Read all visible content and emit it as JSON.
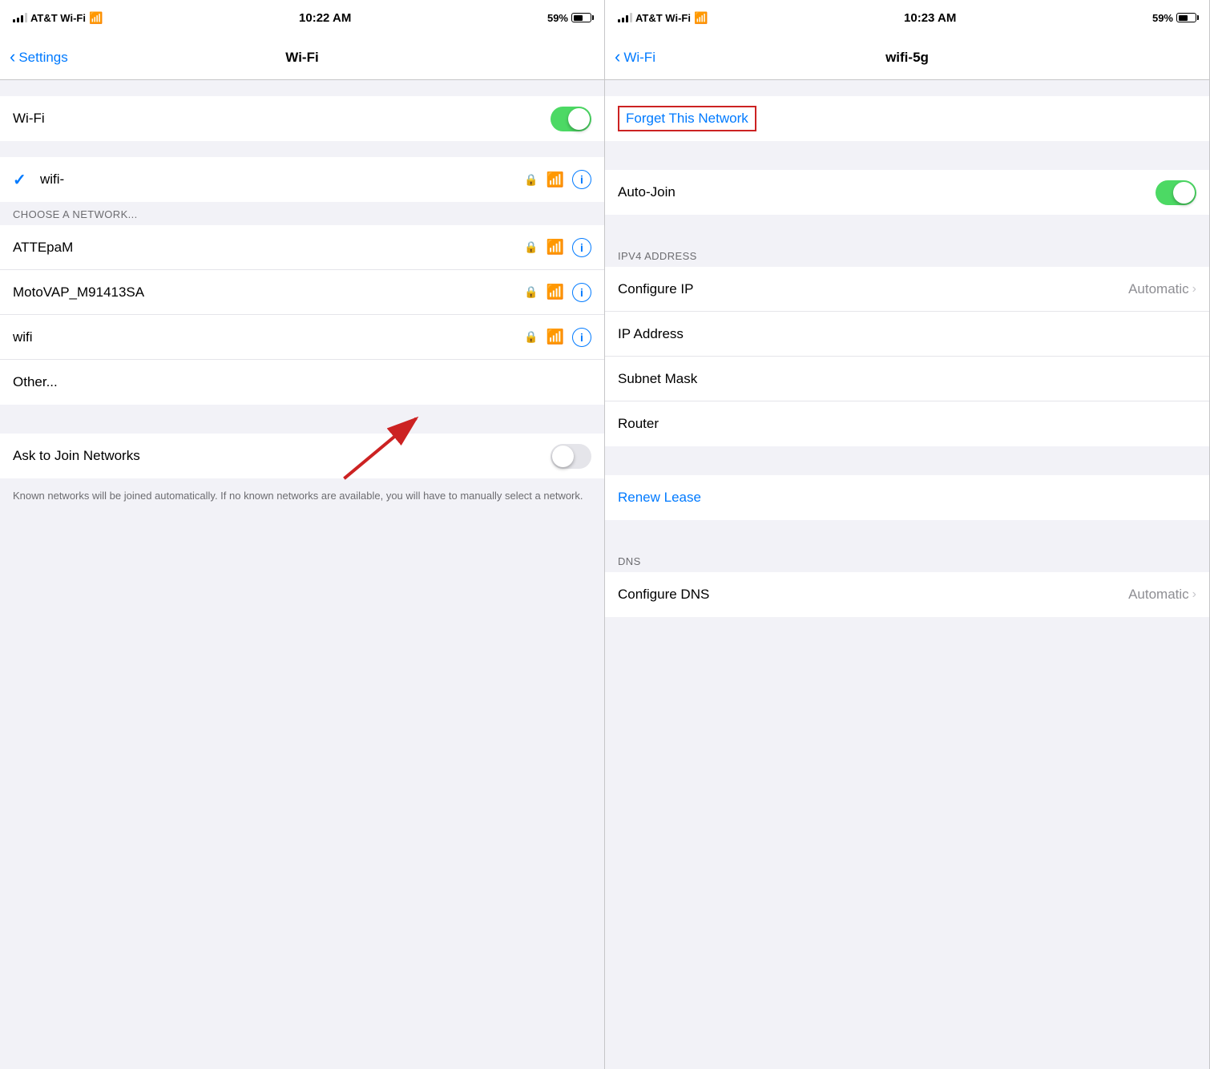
{
  "left_panel": {
    "status_bar": {
      "carrier": "AT&T Wi-Fi",
      "time": "10:22 AM",
      "battery": "59%"
    },
    "nav": {
      "back_label": "Settings",
      "title": "Wi-Fi"
    },
    "wifi_row": {
      "label": "Wi-Fi",
      "toggle_state": "on"
    },
    "connected_network": {
      "name": "wifi-",
      "checkmark": "✓"
    },
    "section_header": "CHOOSE A NETWORK...",
    "networks": [
      {
        "name": "ATTEpaM"
      },
      {
        "name": "MotoVAP_M91413SA"
      },
      {
        "name": "wifi"
      },
      {
        "name": "Other..."
      }
    ],
    "ask_join": {
      "label": "Ask to Join Networks",
      "toggle_state": "off"
    },
    "footer_note": "Known networks will be joined automatically. If no known networks are available, you will have to manually select a network."
  },
  "right_panel": {
    "status_bar": {
      "carrier": "AT&T Wi-Fi",
      "time": "10:23 AM",
      "battery": "59%"
    },
    "nav": {
      "back_label": "Wi-Fi",
      "title": "wifi-5g"
    },
    "forget_label": "Forget This Network",
    "auto_join": {
      "label": "Auto-Join",
      "toggle_state": "on"
    },
    "ipv4_header": "IPV4 ADDRESS",
    "configure_ip": {
      "label": "Configure IP",
      "value": "Automatic"
    },
    "ip_address": {
      "label": "IP Address",
      "value": ""
    },
    "subnet_mask": {
      "label": "Subnet Mask",
      "value": ""
    },
    "router": {
      "label": "Router",
      "value": ""
    },
    "renew_lease": "Renew Lease",
    "dns_header": "DNS",
    "configure_dns": {
      "label": "Configure DNS",
      "value": "Automatic"
    }
  }
}
